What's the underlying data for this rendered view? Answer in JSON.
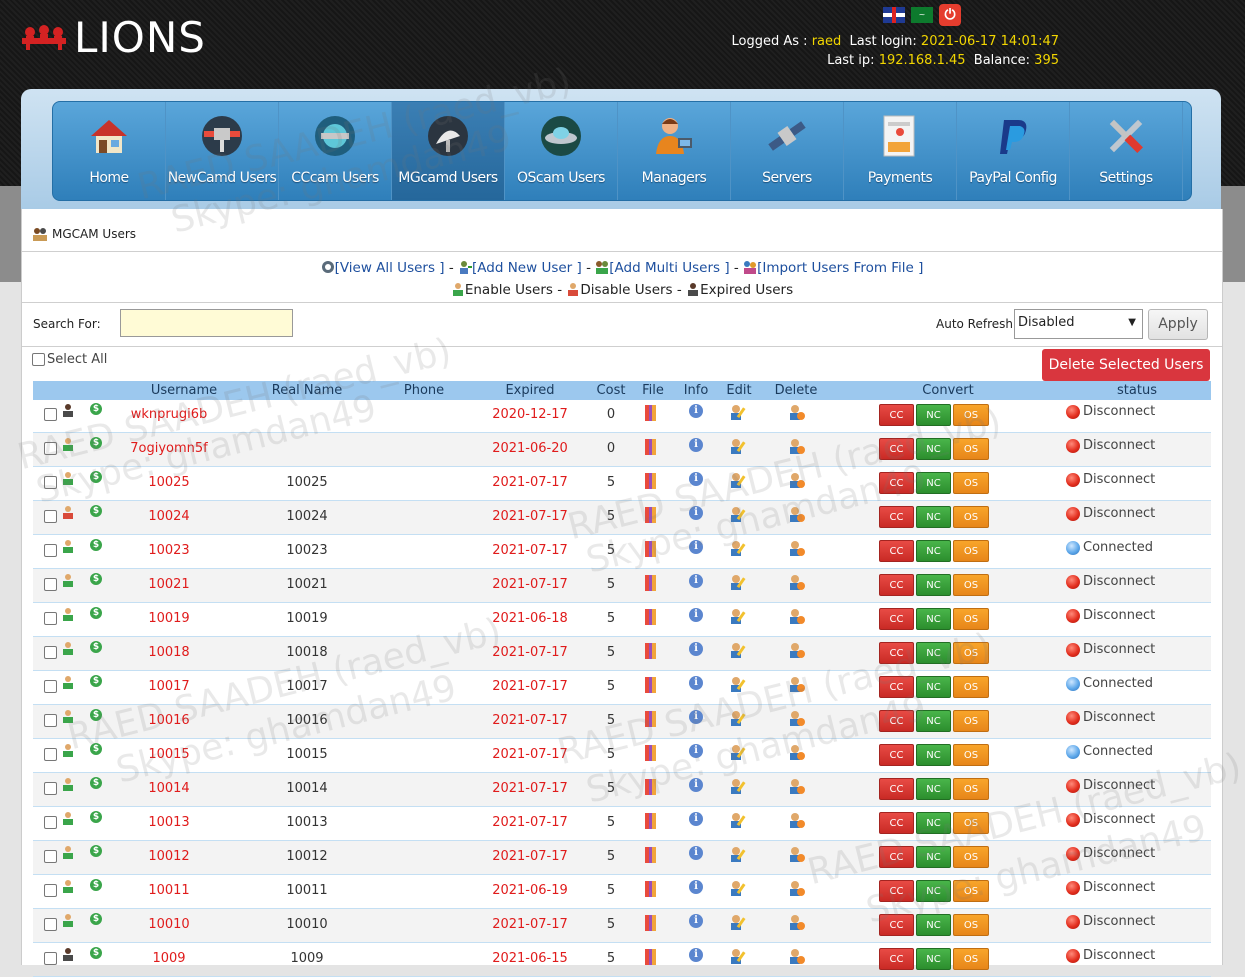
{
  "brand": {
    "name": "LIONS"
  },
  "header": {
    "logged_as_label": "Logged As :",
    "user": "raed",
    "last_login_label": "Last login:",
    "last_login": "2021-06-17 14:01:47",
    "last_ip_label": "Last ip:",
    "last_ip": "192.168.1.45",
    "balance_label": "Balance:",
    "balance": "395"
  },
  "nav": [
    {
      "label": "Home",
      "icon": "house-icon"
    },
    {
      "label": "NewCamd Users",
      "icon": "satellite-dish-icon"
    },
    {
      "label": "CCcam Users",
      "icon": "satellite-globe-icon"
    },
    {
      "label": "MGcamd Users",
      "icon": "satellite-antenna-icon"
    },
    {
      "label": "OScam Users",
      "icon": "ufo-icon"
    },
    {
      "label": "Managers",
      "icon": "manager-icon"
    },
    {
      "label": "Servers",
      "icon": "server-satellite-icon"
    },
    {
      "label": "Payments",
      "icon": "payment-card-icon"
    },
    {
      "label": "PayPal Config",
      "icon": "paypal-icon"
    },
    {
      "label": "Settings",
      "icon": "tools-icon"
    }
  ],
  "page": {
    "title": "MGCAM Users",
    "links": {
      "view_all": "[View All Users ]",
      "add_new": "[Add New User ]",
      "add_multi": "[Add Multi Users ]",
      "import": "[Import Users From File ]",
      "enable": "Enable Users",
      "disable": "Disable Users",
      "expired": "Expired Users"
    },
    "search_label": "Search For:",
    "search_value": "",
    "auto_refresh_label": "Auto Refresh:",
    "auto_refresh_value": "Disabled",
    "apply_label": "Apply",
    "select_all_label": "Select All",
    "delete_selected_label": "Delete Selected Users"
  },
  "table": {
    "columns": [
      "Username",
      "Real Name",
      "Phone",
      "Expired",
      "Cost",
      "File",
      "Info",
      "Edit",
      "Delete",
      "Convert",
      "status"
    ],
    "convert_labels": {
      "cc": "CC",
      "nc": "NC",
      "os": "OS"
    },
    "rows": [
      {
        "username": "wknprugi6b",
        "real_name": "",
        "expired": "2020-12-17",
        "cost": "0",
        "status": "Disconnect",
        "user_type": "dark"
      },
      {
        "username": "7ogiyomn5f",
        "real_name": "",
        "expired": "2021-06-20",
        "cost": "0",
        "status": "Disconnect",
        "user_type": "green"
      },
      {
        "username": "10025",
        "real_name": "10025",
        "expired": "2021-07-17",
        "cost": "5",
        "status": "Disconnect",
        "user_type": "green"
      },
      {
        "username": "10024",
        "real_name": "10024",
        "expired": "2021-07-17",
        "cost": "5",
        "status": "Disconnect",
        "user_type": "red"
      },
      {
        "username": "10023",
        "real_name": "10023",
        "expired": "2021-07-17",
        "cost": "5",
        "status": "Connected",
        "user_type": "green"
      },
      {
        "username": "10021",
        "real_name": "10021",
        "expired": "2021-07-17",
        "cost": "5",
        "status": "Disconnect",
        "user_type": "green"
      },
      {
        "username": "10019",
        "real_name": "10019",
        "expired": "2021-06-18",
        "cost": "5",
        "status": "Disconnect",
        "user_type": "green"
      },
      {
        "username": "10018",
        "real_name": "10018",
        "expired": "2021-07-17",
        "cost": "5",
        "status": "Disconnect",
        "user_type": "green"
      },
      {
        "username": "10017",
        "real_name": "10017",
        "expired": "2021-07-17",
        "cost": "5",
        "status": "Connected",
        "user_type": "green"
      },
      {
        "username": "10016",
        "real_name": "10016",
        "expired": "2021-07-17",
        "cost": "5",
        "status": "Disconnect",
        "user_type": "green"
      },
      {
        "username": "10015",
        "real_name": "10015",
        "expired": "2021-07-17",
        "cost": "5",
        "status": "Connected",
        "user_type": "green"
      },
      {
        "username": "10014",
        "real_name": "10014",
        "expired": "2021-07-17",
        "cost": "5",
        "status": "Disconnect",
        "user_type": "green"
      },
      {
        "username": "10013",
        "real_name": "10013",
        "expired": "2021-07-17",
        "cost": "5",
        "status": "Disconnect",
        "user_type": "green"
      },
      {
        "username": "10012",
        "real_name": "10012",
        "expired": "2021-07-17",
        "cost": "5",
        "status": "Disconnect",
        "user_type": "green"
      },
      {
        "username": "10011",
        "real_name": "10011",
        "expired": "2021-06-19",
        "cost": "5",
        "status": "Disconnect",
        "user_type": "green"
      },
      {
        "username": "10010",
        "real_name": "10010",
        "expired": "2021-07-17",
        "cost": "5",
        "status": "Disconnect",
        "user_type": "green"
      },
      {
        "username": "1009",
        "real_name": "1009",
        "expired": "2021-06-15",
        "cost": "5",
        "status": "Disconnect",
        "user_type": "dark"
      }
    ]
  },
  "watermarks": [
    "RAED SAADEH (raed_vb)",
    "Skype: ghamdan49"
  ],
  "colors": {
    "accent_red": "#e01b1b",
    "nav_blue": "#2f7fba",
    "header_blue": "#9cc8ee",
    "yellow_text": "#f2d600"
  }
}
